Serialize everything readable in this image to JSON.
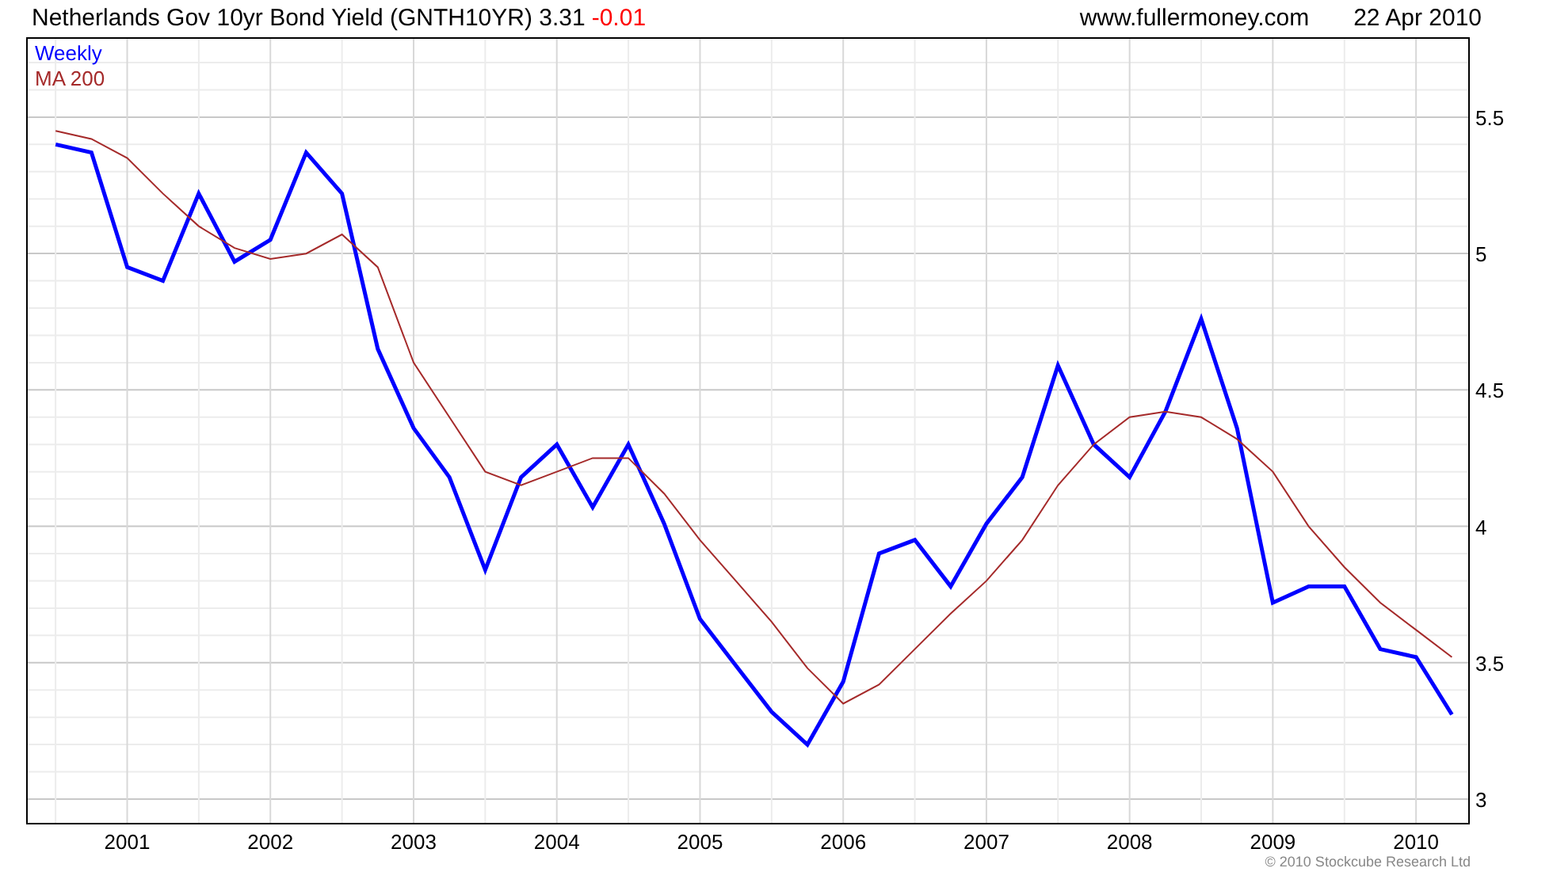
{
  "header": {
    "title": "Netherlands Gov 10yr Bond Yield (GNTH10YR) 3.31",
    "change": "-0.01",
    "site": "www.fullermoney.com",
    "date": "22 Apr 2010"
  },
  "chart": {
    "chart_data": {
      "type": "line",
      "grid": true,
      "xlim": [
        2000.3,
        2010.37
      ],
      "ylim": [
        2.91,
        5.79
      ],
      "x": [
        2000.5,
        2000.75,
        2001,
        2001.25,
        2001.5,
        2001.75,
        2002,
        2002.25,
        2002.5,
        2002.75,
        2003,
        2003.25,
        2003.5,
        2003.75,
        2004,
        2004.25,
        2004.5,
        2004.75,
        2005,
        2005.25,
        2005.5,
        2005.75,
        2006,
        2006.25,
        2006.5,
        2006.75,
        2007,
        2007.25,
        2007.5,
        2007.75,
        2008,
        2008.25,
        2008.5,
        2008.75,
        2009,
        2009.25,
        2009.5,
        2009.75,
        2010,
        2010.25
      ],
      "xticks": [
        {
          "value": 2001,
          "label": "2001"
        },
        {
          "value": 2002,
          "label": "2002"
        },
        {
          "value": 2003,
          "label": "2003"
        },
        {
          "value": 2004,
          "label": "2004"
        },
        {
          "value": 2005,
          "label": "2005"
        },
        {
          "value": 2006,
          "label": "2006"
        },
        {
          "value": 2007,
          "label": "2007"
        },
        {
          "value": 2008,
          "label": "2008"
        },
        {
          "value": 2009,
          "label": "2009"
        },
        {
          "value": 2010,
          "label": "2010"
        }
      ],
      "yticks": [
        3,
        {
          "value": 3.5,
          "label": "3.5"
        },
        4,
        {
          "value": 4.5,
          "label": "4.5"
        },
        5,
        {
          "value": 5.5,
          "label": "5.5"
        }
      ],
      "series": [
        {
          "name": "Weekly",
          "color": "#0000ff",
          "values": [
            5.4,
            5.37,
            4.95,
            4.9,
            5.22,
            4.97,
            5.05,
            5.37,
            5.22,
            4.65,
            4.36,
            4.18,
            3.84,
            4.18,
            4.3,
            4.07,
            4.3,
            4.01,
            3.66,
            3.49,
            3.32,
            3.2,
            3.43,
            3.9,
            3.95,
            3.78,
            4.01,
            4.18,
            4.59,
            4.3,
            4.18,
            4.42,
            4.76,
            4.36,
            3.72,
            3.78,
            3.78,
            3.55,
            3.52,
            3.31
          ]
        },
        {
          "name": "MA 200",
          "color": "#a52a2a",
          "values": [
            5.45,
            5.42,
            5.35,
            5.22,
            5.1,
            5.02,
            4.98,
            5.0,
            5.07,
            4.95,
            4.6,
            4.4,
            4.2,
            4.15,
            4.2,
            4.25,
            4.25,
            4.12,
            3.95,
            3.8,
            3.65,
            3.48,
            3.35,
            3.42,
            3.55,
            3.68,
            3.8,
            3.95,
            4.15,
            4.3,
            4.4,
            4.42,
            4.4,
            4.32,
            4.2,
            4.0,
            3.85,
            3.72,
            3.62,
            3.52
          ]
        }
      ]
    }
  },
  "footer": {
    "copyright": "© 2010 Stockcube Research Ltd"
  }
}
